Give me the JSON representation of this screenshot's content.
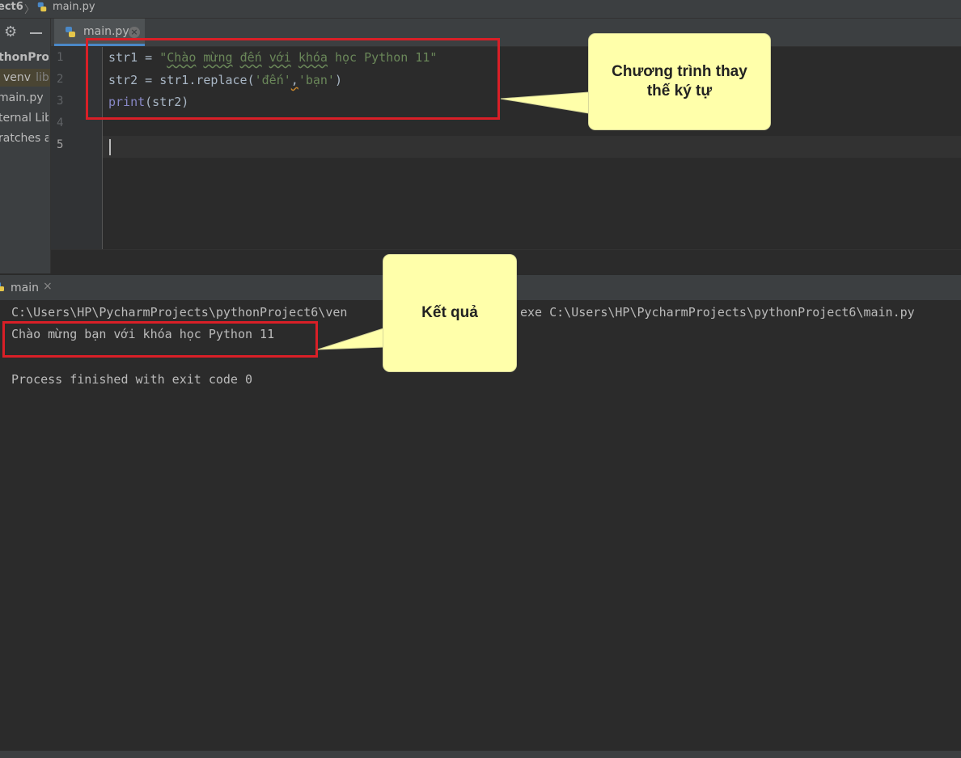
{
  "breadcrumb": {
    "project": "ect6",
    "file": "main.py"
  },
  "project_panel": {
    "root": "thonProje",
    "venv_name": "venv",
    "venv_suffix": "libr",
    "main_file": "main.py",
    "external_libraries": "ternal Libr",
    "scratches": "ratches an"
  },
  "editor": {
    "tab_label": "main.py",
    "line_numbers": [
      "1",
      "2",
      "3",
      "4",
      "5"
    ],
    "code": {
      "line1_var": "str1 = ",
      "line1_str_open": "\"",
      "line1_w1": "Chào",
      "line1_sp1": " ",
      "line1_w2": "mừng",
      "line1_sp2": " ",
      "line1_w3": "đến",
      "line1_sp3": " ",
      "line1_w4": "với",
      "line1_sp4": " ",
      "line1_w5": "khóa",
      "line1_rest": " học Python 11\"",
      "line2_prefix": "str2 = str1.replace(",
      "line2_arg1": "'đến'",
      "line2_comma": ",",
      "line2_arg2": "'bạn'",
      "line2_suffix": ")",
      "line3_kw": "print",
      "line3_rest": "(str2)"
    }
  },
  "run_panel": {
    "tab_label": "main",
    "command_left": "C:\\Users\\HP\\PycharmProjects\\pythonProject6\\ven",
    "command_right": "exe C:\\Users\\HP\\PycharmProjects\\pythonProject6\\main.py",
    "output": "Chào mừng bạn với khóa học Python 11",
    "exit_message": "Process finished with exit code 0"
  },
  "annotations": {
    "code_callout_line1": "Chương trình thay",
    "code_callout_line2": "thế ký tự",
    "result_callout": "Kết quả"
  },
  "colors": {
    "highlight_box": "#d91f27",
    "callout_bg": "#ffffaa",
    "string": "#6a8759",
    "keyword_print": "#8888c6"
  }
}
